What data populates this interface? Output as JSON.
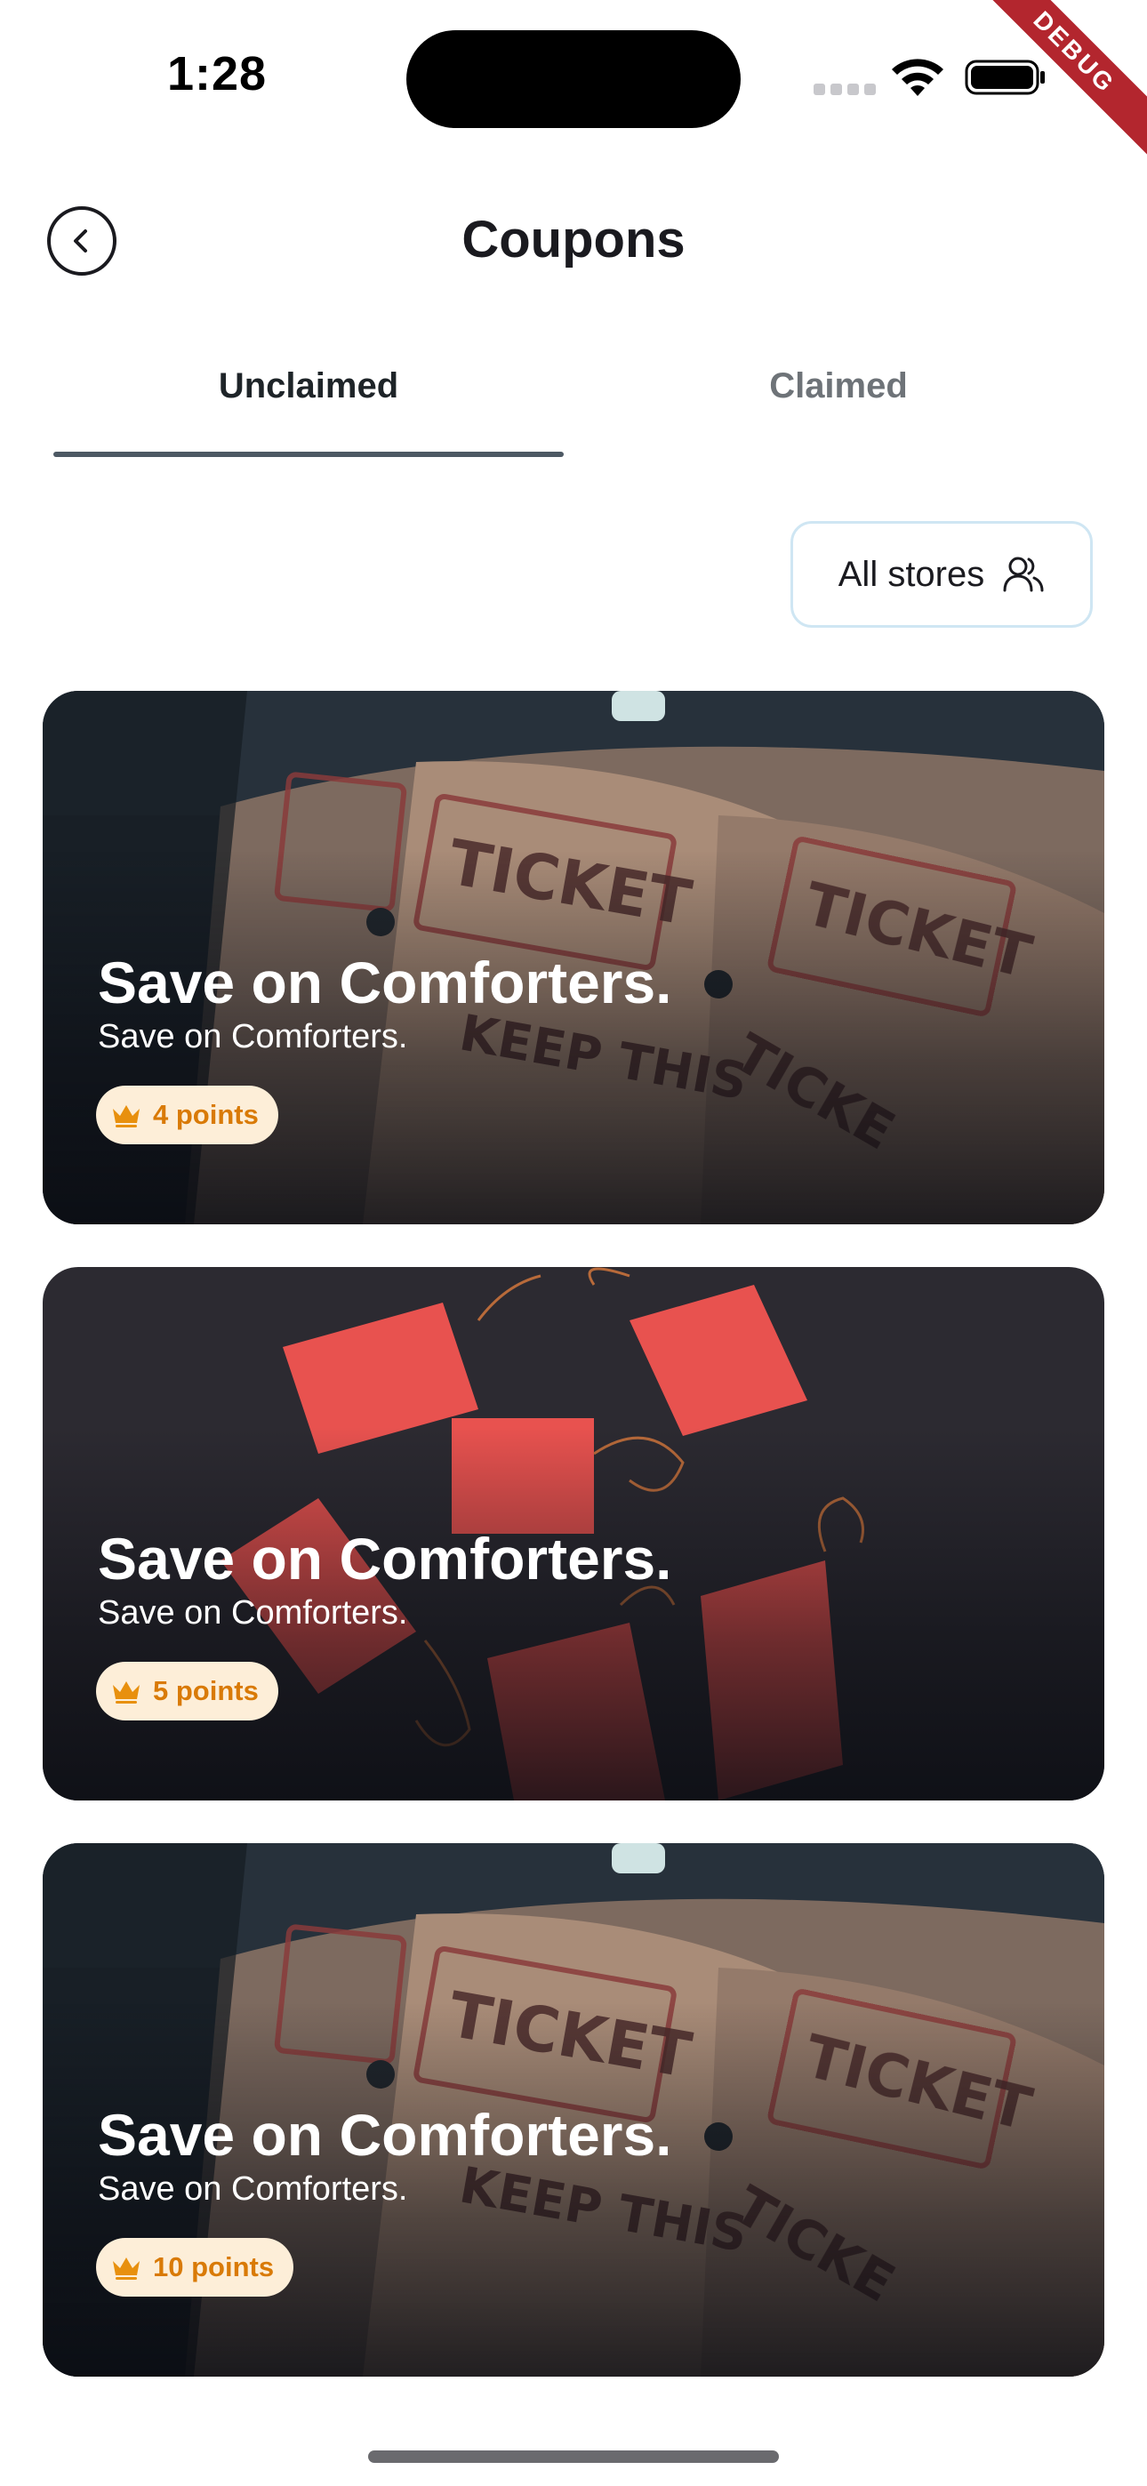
{
  "status_bar": {
    "time": "1:28",
    "debug_label": "DEBUG"
  },
  "header": {
    "title": "Coupons",
    "back_icon": "chevron-left-icon"
  },
  "tabs": [
    {
      "label": "Unclaimed",
      "active": true
    },
    {
      "label": "Claimed",
      "active": false
    }
  ],
  "filter": {
    "label": "All stores",
    "icon": "users-icon"
  },
  "coupons": [
    {
      "title": "Save on Comforters.",
      "subtitle": "Save on Comforters.",
      "points": "4 points",
      "image": "ticket-roll-photo"
    },
    {
      "title": "Save on Comforters.",
      "subtitle": "Save on Comforters.",
      "points": "5 points",
      "image": "red-gift-tags-photo"
    },
    {
      "title": "Save on Comforters.",
      "subtitle": "Save on Comforters.",
      "points": "10 points",
      "image": "ticket-roll-photo"
    }
  ],
  "colors": {
    "accent_indicator": "#4d5964",
    "points_badge_bg": "#fdeed8",
    "points_text": "#d97a06",
    "filter_border": "#cfe6f3",
    "debug_ribbon": "#b3262e"
  }
}
